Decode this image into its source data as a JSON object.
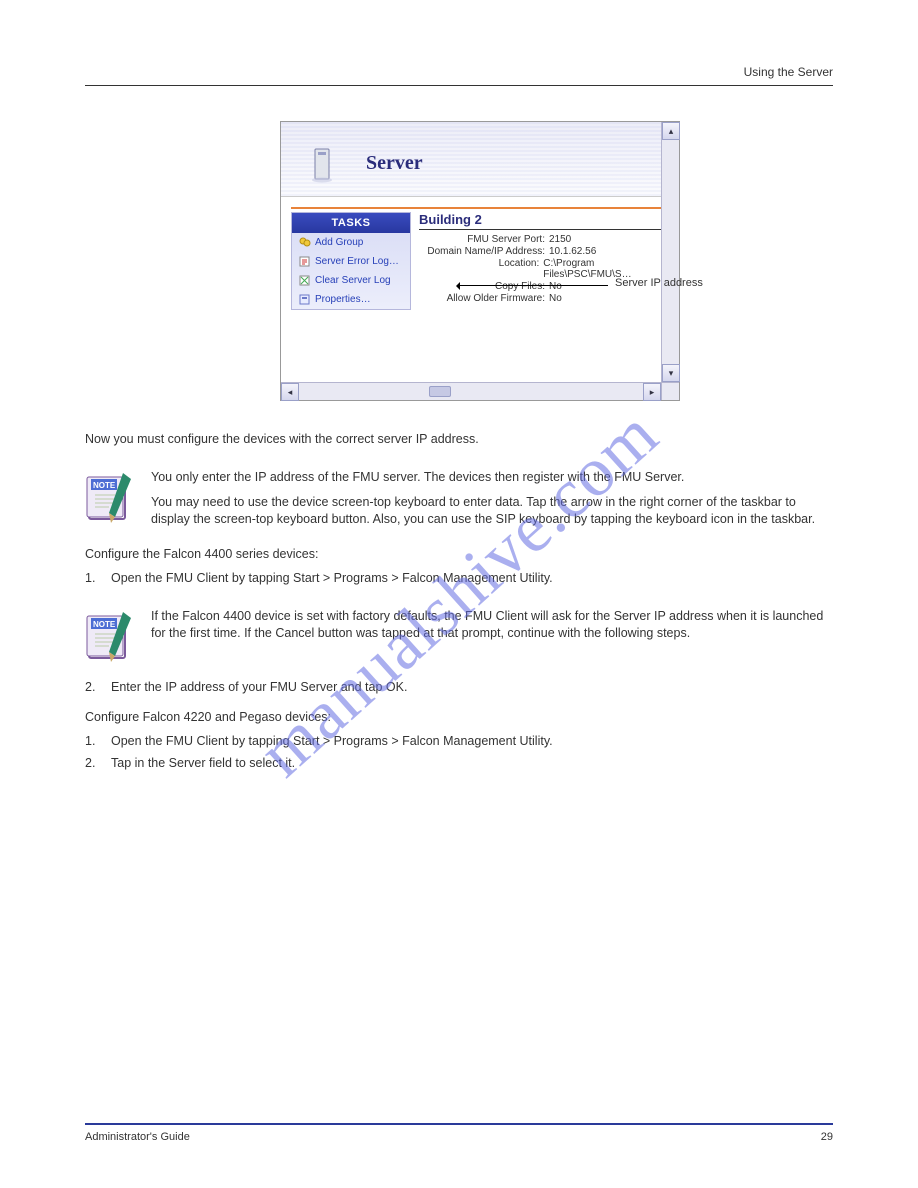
{
  "header": {
    "title": "Using the Server"
  },
  "screenshot": {
    "title": "Server",
    "tasks_header": "TASKS",
    "tasks": [
      {
        "label": "Add Group"
      },
      {
        "label": "Server Error Log…"
      },
      {
        "label": "Clear Server Log"
      },
      {
        "label": "Properties…"
      }
    ],
    "details_heading": "Building 2",
    "rows": [
      {
        "k": "FMU Server Port:",
        "v": "2150"
      },
      {
        "k": "Domain Name/IP Address:",
        "v": "10.1.62.56"
      },
      {
        "k": "Location:",
        "v": "C:\\Program Files\\PSC\\FMU\\S…"
      },
      {
        "k": "Copy Files:",
        "v": "No"
      },
      {
        "k": "Allow Older Firmware:",
        "v": "No"
      }
    ],
    "arrow_label": "Server IP address"
  },
  "body": {
    "para1": "Now you must configure the devices with the correct server IP address.",
    "note1a": "You only enter the IP address of the FMU server. The devices then register with the FMU Server.",
    "note1b": "You may need to use the device screen-top keyboard to enter data. Tap the arrow in the right corner of the taskbar to display the screen-top keyboard button. Also, you can use the SIP keyboard by tapping the keyboard icon in the taskbar.",
    "config1": "Configure the Falcon 4400 series devices:",
    "step1_label": "1.",
    "step1": "Open the FMU Client by tapping Start > Programs > Falcon Management Utility.",
    "note2": "If the Falcon 4400 device is set with factory defaults, the FMU Client will ask for the Server IP address when it is launched for the first time. If the Cancel button was tapped at that prompt, continue with the following steps.",
    "step2_label": "2.",
    "step2": "Enter the IP address of your FMU Server and tap OK.",
    "config2": "Configure Falcon 4220 and Pegaso devices:",
    "pstep1_label": "1.",
    "pstep1": "Open the FMU Client by tapping Start > Programs > Falcon Management Utility.",
    "pstep2_label": "2.",
    "pstep2": "Tap in the Server field to select it."
  },
  "footer": {
    "left": "Administrator's Guide",
    "right": "29"
  },
  "watermark": "manualshive.com"
}
